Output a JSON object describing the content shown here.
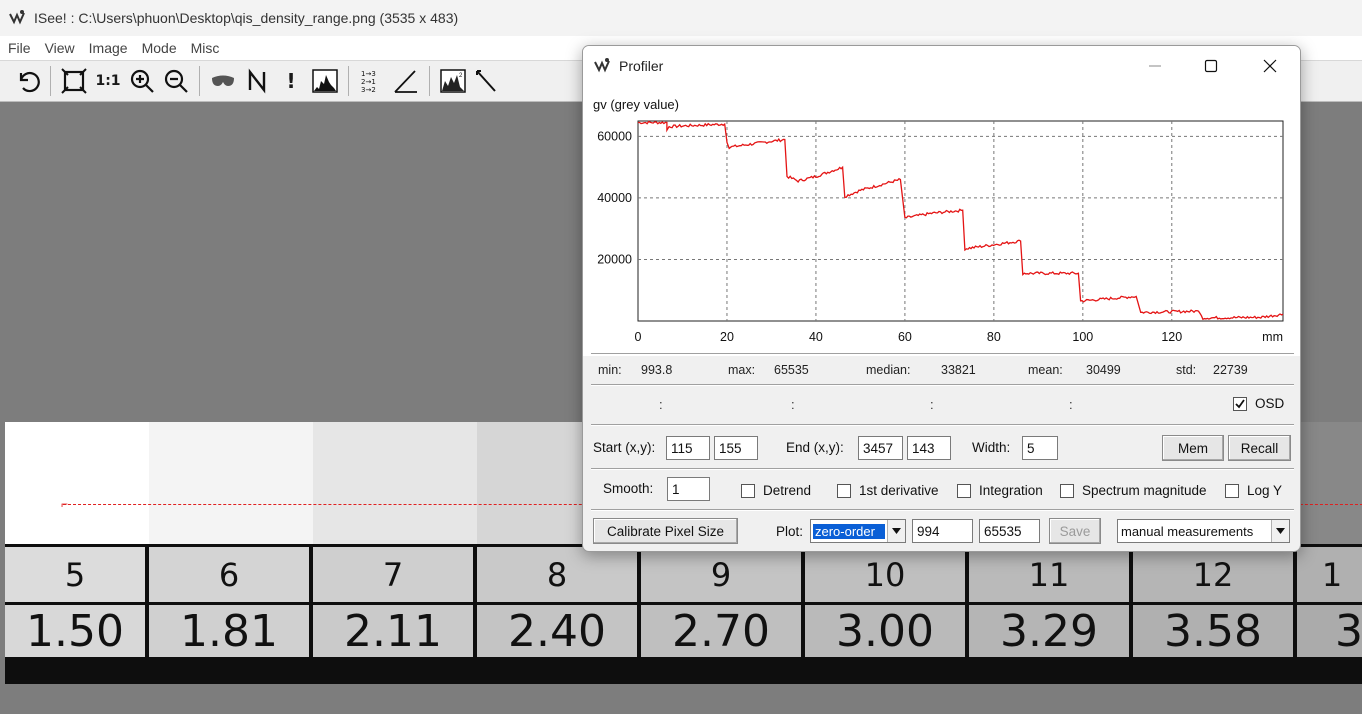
{
  "window": {
    "title": "ISee! : C:\\Users\\phuon\\Desktop\\qis_density_range.png (3535 x 483)"
  },
  "menu": [
    "File",
    "View",
    "Image",
    "Mode",
    "Misc"
  ],
  "toolbar": {
    "one_to_one": "1:1",
    "n_label": "N",
    "exclamation": "!",
    "icons": [
      "undo-icon",
      "fit-window-icon",
      "one-to-one-icon",
      "zoom-in-icon",
      "zoom-out-icon",
      "mask-icon",
      "n-icon",
      "exclamation-icon",
      "histogram-icon",
      "sort-icon",
      "angle-icon",
      "image-hist-icon",
      "profile-line-icon"
    ]
  },
  "image_strip": {
    "numbers": [
      "5",
      "6",
      "7",
      "8",
      "9",
      "10",
      "11",
      "12",
      "1"
    ],
    "densities": [
      "1.50",
      "1.81",
      "2.11",
      "2.40",
      "2.70",
      "3.00",
      "3.29",
      "3.58",
      "3"
    ],
    "patch_greys": [
      "#ffffff",
      "#f4f4f4",
      "#e6e6e6",
      "#d6d6d6",
      "#c4c4c4",
      "#b4b4b4",
      "#a4a4a4",
      "#949494",
      "#888888"
    ]
  },
  "profiler": {
    "title": "Profiler",
    "chart_data": {
      "type": "line",
      "ylabel": "gv (grey value)",
      "xlabel": "mm",
      "xlim": [
        0,
        145
      ],
      "ylim": [
        0,
        65000
      ],
      "xticks": [
        0,
        20,
        40,
        60,
        80,
        100,
        120
      ],
      "yticks": [
        20000,
        40000,
        60000
      ],
      "grid": true,
      "line_color": "#e41414",
      "series": [
        {
          "points": [
            [
              0,
              64500
            ],
            [
              6.5,
              64500
            ],
            [
              6.5,
              62000
            ],
            [
              7,
              63200
            ],
            [
              19.5,
              64000
            ],
            [
              20,
              58000
            ],
            [
              20.5,
              56500
            ],
            [
              33,
              59000
            ],
            [
              33.5,
              47000
            ],
            [
              36,
              45500
            ],
            [
              40,
              47000
            ],
            [
              46,
              50000
            ],
            [
              46.5,
              40500
            ],
            [
              50,
              42500
            ],
            [
              59,
              46000
            ],
            [
              60,
              33500
            ],
            [
              66,
              35000
            ],
            [
              73,
              36000
            ],
            [
              73.5,
              23500
            ],
            [
              86,
              26000
            ],
            [
              86.5,
              15500
            ],
            [
              99,
              15500
            ],
            [
              99.5,
              6500
            ],
            [
              112,
              8000
            ],
            [
              113,
              2800
            ],
            [
              126,
              3200
            ],
            [
              127,
              1000
            ],
            [
              140,
              1200
            ],
            [
              145,
              2200
            ]
          ]
        }
      ]
    },
    "stats": {
      "min_label": "min:",
      "min_value": "993.8",
      "max_label": "max:",
      "max_value": "65535",
      "median_label": "median:",
      "median_value": "33821",
      "mean_label": "mean:",
      "mean_value": "30499",
      "std_label": "std:",
      "std_value": "22739"
    },
    "osd": {
      "label": "OSD",
      "checked": true
    },
    "coords": {
      "start_label": "Start (x,y):",
      "start_x": "115",
      "start_y": "155",
      "end_label": "End (x,y):",
      "end_x": "3457",
      "end_y": "143",
      "width_label": "Width:",
      "width_value": "5",
      "mem_label": "Mem",
      "recall_label": "Recall"
    },
    "options": {
      "smooth_label": "Smooth:",
      "smooth_value": "1",
      "detrend": "Detrend",
      "first_derivative": "1st derivative",
      "integration": "Integration",
      "spectrum": "Spectrum magnitude",
      "logy": "Log Y"
    },
    "bottom": {
      "calibrate_label": "Calibrate Pixel Size",
      "plot_label": "Plot:",
      "plot_mode": "zero-order",
      "range_min": "994",
      "range_max": "65535",
      "save_label": "Save",
      "measure_mode": "manual measurements"
    }
  }
}
